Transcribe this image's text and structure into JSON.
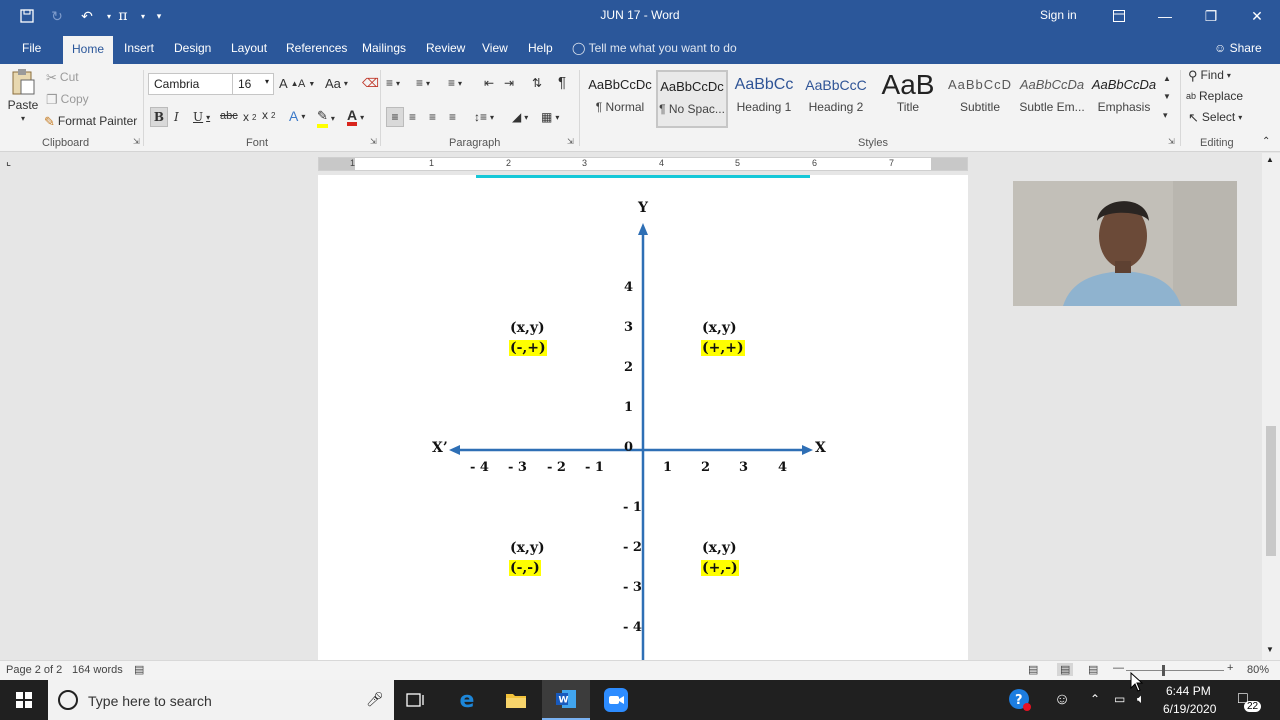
{
  "window": {
    "title": "JUN 17  -  Word",
    "sign_in": "Sign in"
  },
  "ribbon_tabs": [
    "File",
    "Home",
    "Insert",
    "Design",
    "Layout",
    "References",
    "Mailings",
    "Review",
    "View",
    "Help"
  ],
  "tell_me": "Tell me what you want to do",
  "share": "Share",
  "clipboard": {
    "paste": "Paste",
    "cut": "Cut",
    "copy": "Copy",
    "format_painter": "Format Painter",
    "label": "Clipboard"
  },
  "font": {
    "name": "Cambria",
    "size": "16",
    "label": "Font"
  },
  "paragraph": {
    "label": "Paragraph"
  },
  "styles": {
    "label": "Styles",
    "items": [
      {
        "preview": "AaBbCcDc",
        "name": "¶ Normal"
      },
      {
        "preview": "AaBbCcDc",
        "name": "¶ No Spac..."
      },
      {
        "preview": "AaBbCc",
        "name": "Heading 1"
      },
      {
        "preview": "AaBbCcC",
        "name": "Heading 2"
      },
      {
        "preview": "AaB",
        "name": "Title"
      },
      {
        "preview": "AaBbCcD",
        "name": "Subtitle"
      },
      {
        "preview": "AaBbCcDa",
        "name": "Subtle Em..."
      },
      {
        "preview": "AaBbCcDa",
        "name": "Emphasis"
      }
    ]
  },
  "editing": {
    "find": "Find",
    "replace": "Replace",
    "select": "Select",
    "label": "Editing"
  },
  "ruler_numbers": [
    "1",
    "1",
    "2",
    "3",
    "4",
    "5",
    "6",
    "7"
  ],
  "graph": {
    "y_axis_label": "Y",
    "x_axis_label": "X",
    "x_neg_label": "X’",
    "origin": "0",
    "x_ticks_neg": [
      "- 4",
      "- 3",
      "- 2",
      "- 1"
    ],
    "x_ticks_pos": [
      "1",
      "2",
      "3",
      "4"
    ],
    "y_ticks_pos": [
      "4",
      "3",
      "2",
      "1"
    ],
    "y_ticks_neg": [
      "- 1",
      "- 2",
      "- 3",
      "- 4"
    ],
    "quadrants": {
      "q1": {
        "pair": "(x,y)",
        "signs": "(+,+)"
      },
      "q2": {
        "pair": "(x,y)",
        "signs": "(-,+)"
      },
      "q3": {
        "pair": "(x,y)",
        "signs": "(-,-)"
      },
      "q4": {
        "pair": "(x,y)",
        "signs": "(+,-)"
      }
    },
    "axis_color": "#2e6fb5",
    "highlight_color": "#ffff00"
  },
  "status": {
    "page": "Page 2 of 2",
    "words": "164 words",
    "zoom": "80%"
  },
  "taskbar": {
    "search_placeholder": "Type here to search",
    "time": "6:44 PM",
    "date": "6/19/2020",
    "notifications": "22"
  }
}
